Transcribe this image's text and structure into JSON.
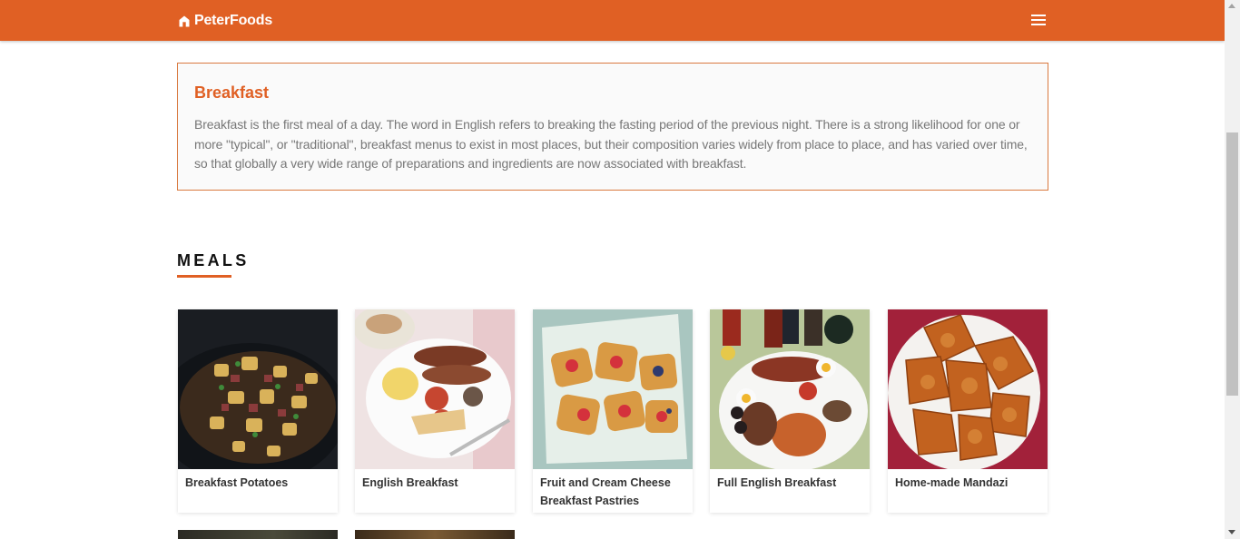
{
  "navbar": {
    "brand_name": "PeterFoods",
    "brand_icon": "home-icon",
    "menu_icon": "hamburger-menu-icon",
    "background_color": "#e06024"
  },
  "intro": {
    "title": "Breakfast",
    "description": "Breakfast is the first meal of a day. The word in English refers to breaking the fasting period of the previous night. There is a strong likelihood for one or more \"typical\", or \"traditional\", breakfast menus to exist in most places, but their composition varies widely from place to place, and has varied over time, so that globally a very wide range of preparations and ingredients are now associated with breakfast."
  },
  "meals": {
    "heading": "MEALS",
    "items": [
      {
        "name": "Breakfast Potatoes"
      },
      {
        "name": "English Breakfast"
      },
      {
        "name": "Fruit and Cream Cheese Breakfast Pastries"
      },
      {
        "name": "Full English Breakfast"
      },
      {
        "name": "Home-made Mandazi"
      }
    ]
  },
  "colors": {
    "accent": "#e06024",
    "border": "#d9793f"
  }
}
